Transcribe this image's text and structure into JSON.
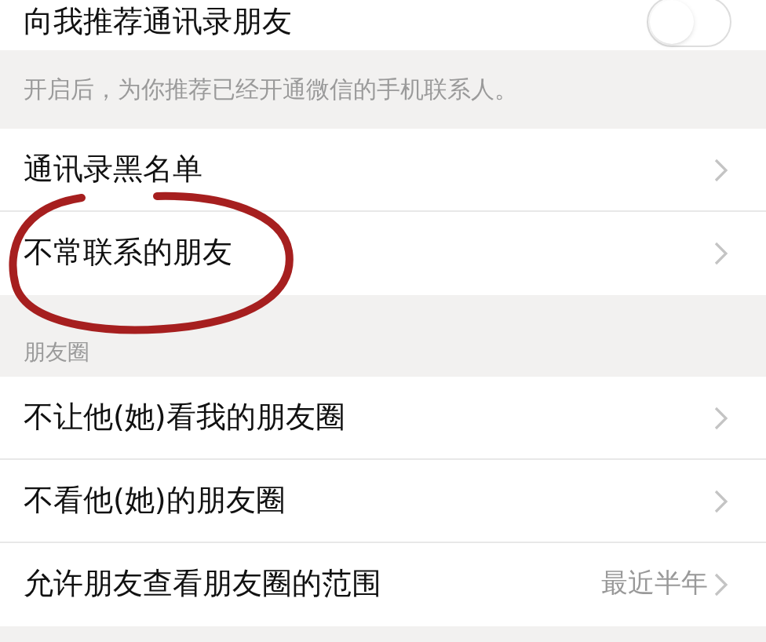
{
  "top_setting": {
    "label": "向我推荐通讯录朋友",
    "on": false
  },
  "hint": "开启后，为你推荐已经开通微信的手机联系人。",
  "contacts_items": [
    {
      "label": "通讯录黑名单"
    },
    {
      "label": "不常联系的朋友"
    }
  ],
  "moments_section": {
    "header": "朋友圈",
    "items": [
      {
        "label": "不让他(她)看我的朋友圈"
      },
      {
        "label": "不看他(她)的朋友圈"
      },
      {
        "label": "允许朋友查看朋友圈的范围",
        "value": "最近半年"
      }
    ]
  }
}
